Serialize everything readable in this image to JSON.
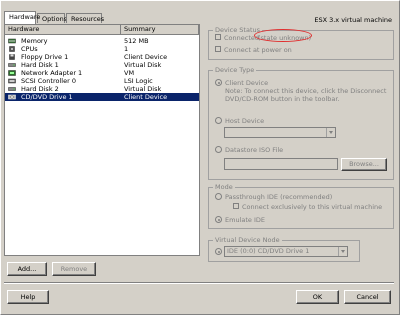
{
  "window": {
    "vm_title": "ESX 3.x virtual machine"
  },
  "tabs": [
    {
      "label": "Hardware"
    },
    {
      "label": "Options"
    },
    {
      "label": "Resources"
    }
  ],
  "hardware_list": {
    "col_hardware": "Hardware",
    "col_summary": "Summary",
    "rows": [
      {
        "name": "Memory",
        "summary": "512 MB",
        "icon": "memory-icon"
      },
      {
        "name": "CPUs",
        "summary": "1",
        "icon": "cpu-icon"
      },
      {
        "name": "Floppy Drive 1",
        "summary": "Client Device",
        "icon": "floppy-icon"
      },
      {
        "name": "Hard Disk 1",
        "summary": "Virtual Disk",
        "icon": "hard-disk-icon"
      },
      {
        "name": "Network Adapter 1",
        "summary": "VM",
        "icon": "network-icon"
      },
      {
        "name": "SCSI Controller 0",
        "summary": "LSI Logic",
        "icon": "scsi-icon"
      },
      {
        "name": "Hard Disk 2",
        "summary": "Virtual Disk",
        "icon": "hard-disk-icon"
      },
      {
        "name": "CD/DVD Drive 1",
        "summary": "Client Device",
        "icon": "cdrom-icon",
        "selected": true
      }
    ]
  },
  "buttons": {
    "add": "Add...",
    "remove": "Remove",
    "help": "Help",
    "ok": "OK",
    "cancel": "Cancel"
  },
  "device_status": {
    "title": "Device Status",
    "connected": "Connected",
    "connected_value": "(state unknown)",
    "connect_at_power_on": "Connect at power on"
  },
  "device_type": {
    "title": "Device Type",
    "client_device": "Client Device",
    "note": "Note: To connect this device, click the Disconnect",
    "note2": "DVD/CD-ROM button in the toolbar.",
    "host_device": "Host Device",
    "iso_file": "Datastore ISO File",
    "browse": "Browse..."
  },
  "mode": {
    "title": "Mode",
    "passthrough": "Passthrough IDE (recommended)",
    "exclusive": "Connect exclusively to this virtual machine",
    "emulate": "Emulate IDE"
  },
  "virtual_device_node": {
    "title": "Virtual Device Node",
    "value": "IDE (0:0) CD/DVD Drive 1"
  },
  "colors": {
    "selection": "#0a246a",
    "highlight_ellipse": "#e03030",
    "dialog_bg": "#d4d0c8"
  }
}
